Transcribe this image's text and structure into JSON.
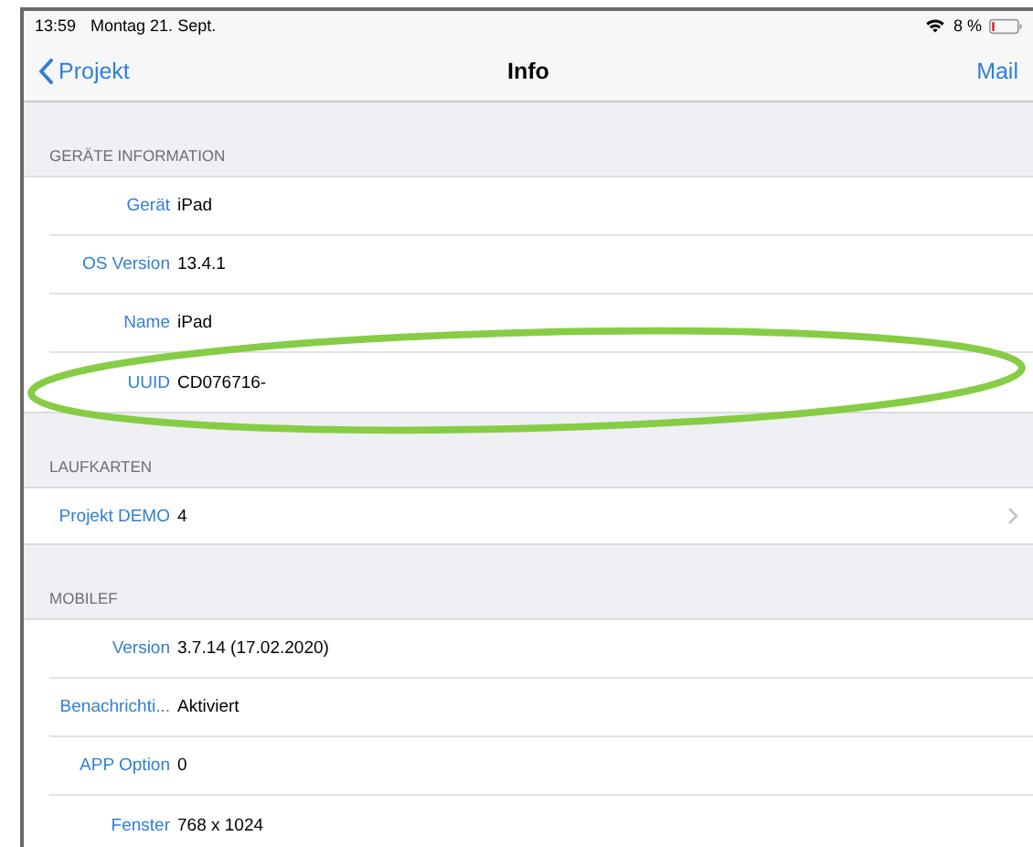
{
  "status_bar": {
    "time": "13:59",
    "date": "Montag 21. Sept.",
    "battery": "8 %"
  },
  "nav": {
    "back": "Projekt",
    "title": "Info",
    "action": "Mail"
  },
  "sections": [
    {
      "title": "GERÄTE INFORMATION",
      "rows": [
        {
          "label": "Gerät",
          "value": "iPad",
          "disclosure": false,
          "highlighted": false
        },
        {
          "label": "OS Version",
          "value": "13.4.1",
          "disclosure": false,
          "highlighted": false
        },
        {
          "label": "Name",
          "value": "iPad",
          "disclosure": false,
          "highlighted": false
        },
        {
          "label": "UUID",
          "value": "CD076716-",
          "disclosure": false,
          "highlighted": true
        }
      ]
    },
    {
      "title": "LAUFKARTEN",
      "rows": [
        {
          "label": "Projekt DEMO",
          "value": "4",
          "disclosure": true,
          "highlighted": false
        }
      ]
    },
    {
      "title": "MOBILEF",
      "rows": [
        {
          "label": "Version",
          "value": "3.7.14 (17.02.2020)",
          "disclosure": false,
          "highlighted": false
        },
        {
          "label": "Benachrichti...",
          "value": "Aktiviert",
          "disclosure": false,
          "highlighted": false
        },
        {
          "label": "APP Option",
          "value": "0",
          "disclosure": false,
          "highlighted": false
        },
        {
          "label": "Fenster",
          "value": "768 x 1024",
          "disclosure": false,
          "highlighted": false
        }
      ]
    }
  ]
}
